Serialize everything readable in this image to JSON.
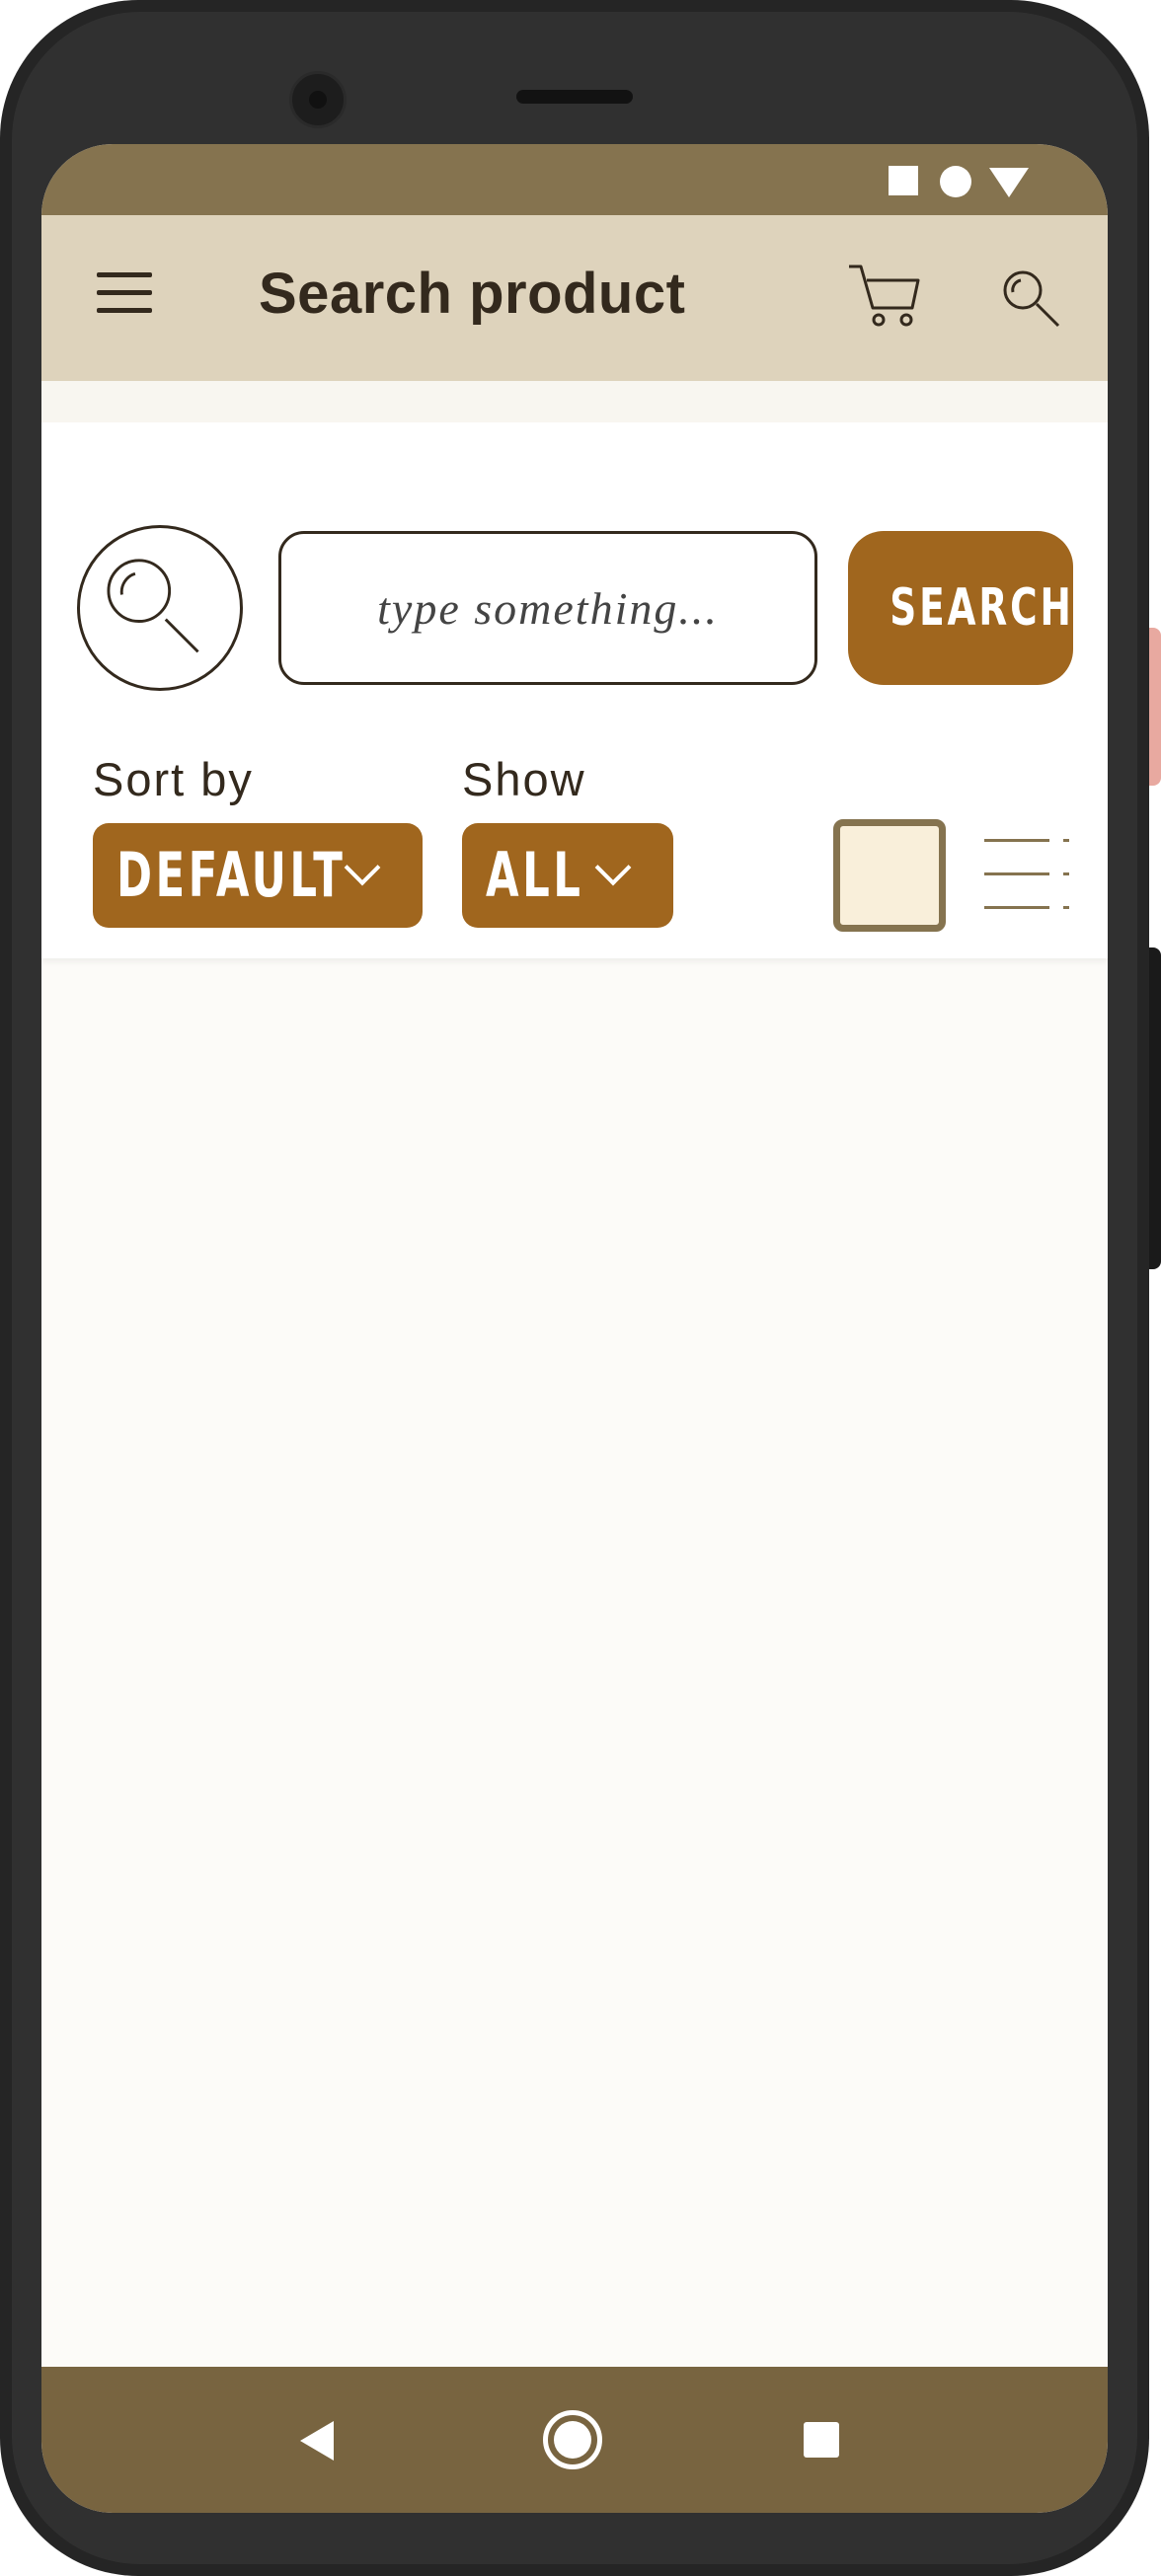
{
  "app": {
    "title": "Search product"
  },
  "search": {
    "placeholder": "type something...",
    "button_label": "SEARCH"
  },
  "sort": {
    "label": "Sort by",
    "selected": "DEFAULT"
  },
  "show": {
    "label": "Show",
    "selected": "ALL"
  },
  "view_modes": [
    "grid",
    "list"
  ],
  "icons": {
    "menu": "hamburger-menu-icon",
    "cart": "shopping-cart-icon",
    "search": "magnifier-icon",
    "back": "back-triangle-icon",
    "home": "home-circle-icon",
    "recent": "recent-apps-square-icon"
  },
  "colors": {
    "status_bar": "#85734f",
    "app_bar": "#ded3bc",
    "accent": "#a0661e",
    "text_dark": "#33291d",
    "grid_fill": "#f9efda",
    "nav_bar": "#786440"
  }
}
